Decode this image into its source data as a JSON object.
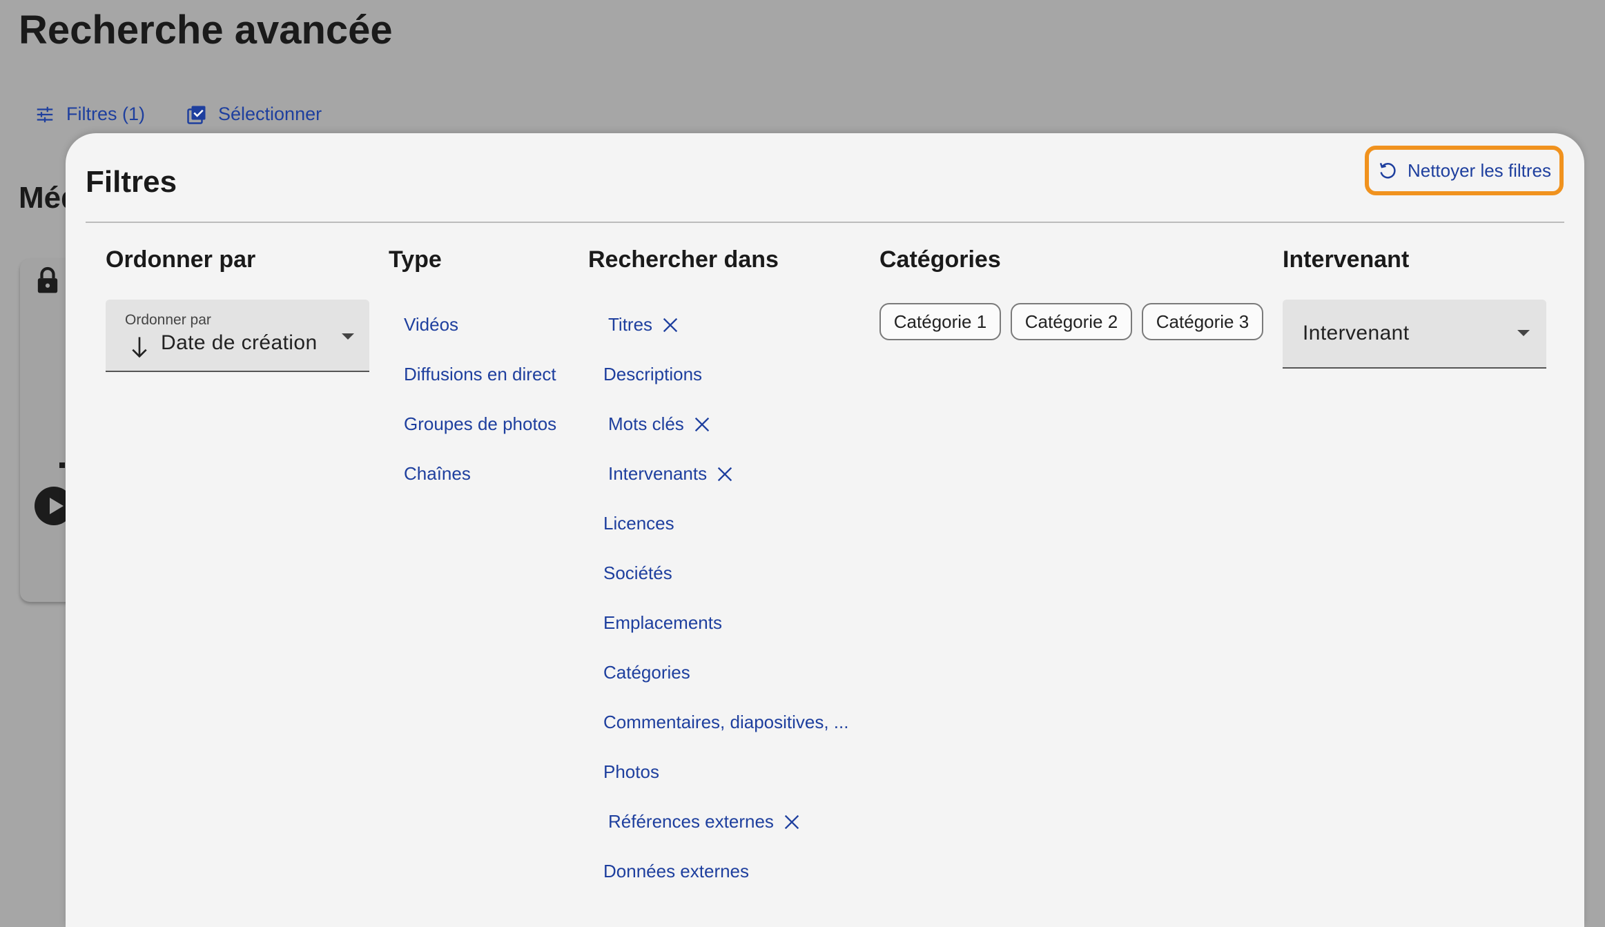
{
  "page": {
    "title": "Recherche avancée",
    "section_partial": "Méd"
  },
  "toolbar": {
    "filters_label": "Filtres (1)",
    "select_label": "Sélectionner"
  },
  "panel": {
    "title": "Filtres",
    "clear_label": "Nettoyer les filtres",
    "order": {
      "heading": "Ordonner par",
      "caption": "Ordonner par",
      "value": "Date de création"
    },
    "type": {
      "heading": "Type",
      "items": [
        "Vidéos",
        "Diffusions en direct",
        "Groupes de photos",
        "Chaînes"
      ]
    },
    "search_in": {
      "heading": "Rechercher dans",
      "items": [
        {
          "label": "Titres",
          "selected": true
        },
        {
          "label": "Descriptions",
          "selected": false
        },
        {
          "label": "Mots clés",
          "selected": true
        },
        {
          "label": "Intervenants",
          "selected": true
        },
        {
          "label": "Licences",
          "selected": false
        },
        {
          "label": "Sociétés",
          "selected": false
        },
        {
          "label": "Emplacements",
          "selected": false
        },
        {
          "label": "Catégories",
          "selected": false
        },
        {
          "label": "Commentaires, diapositives, ...",
          "selected": false
        },
        {
          "label": "Photos",
          "selected": false
        },
        {
          "label": "Références externes",
          "selected": true
        },
        {
          "label": "Données externes",
          "selected": false
        }
      ]
    },
    "categories": {
      "heading": "Catégories",
      "chips": [
        "Catégorie 1",
        "Catégorie 2",
        "Catégorie 3"
      ]
    },
    "speaker": {
      "heading": "Intervenant",
      "placeholder": "Intervenant"
    }
  },
  "colors": {
    "link": "#1e3f9e",
    "highlight": "#f0921e",
    "panel_bg": "#f4f4f4",
    "overlay_bg": "#a6a6a6"
  }
}
